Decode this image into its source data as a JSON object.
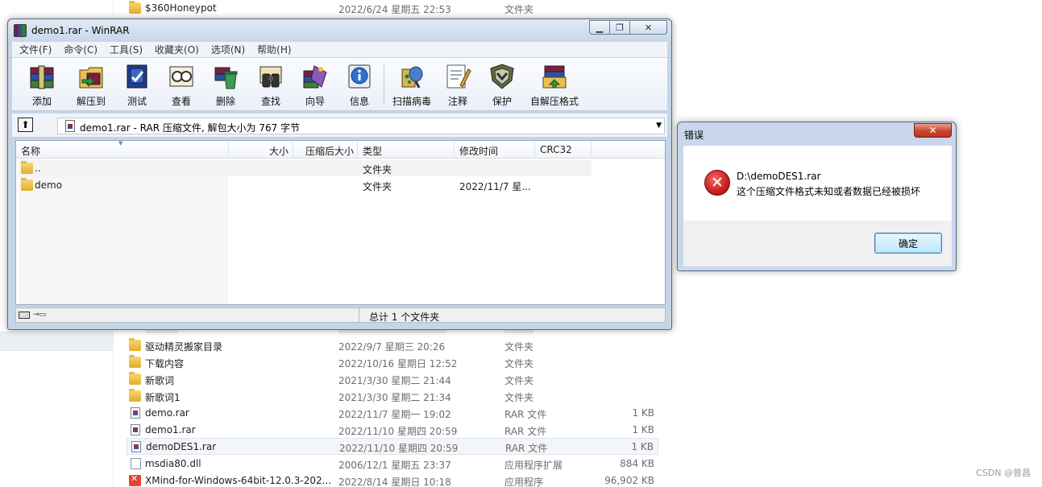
{
  "explorer": {
    "rows_top": [
      {
        "name": "$360Honeypot",
        "date": "2022/6/24 星期五 22:53",
        "type": "文件夹",
        "size": "",
        "icon": "folder-icon"
      }
    ],
    "rows_bottom": [
      {
        "name": "驱动精灵搬家目录",
        "date": "2022/9/7 星期三 20:26",
        "type": "文件夹",
        "size": "",
        "icon": "folder-icon"
      },
      {
        "name": "下载内容",
        "date": "2022/10/16 星期日 12:52",
        "type": "文件夹",
        "size": "",
        "icon": "folder-icon"
      },
      {
        "name": "新歌词",
        "date": "2021/3/30 星期二 21:44",
        "type": "文件夹",
        "size": "",
        "icon": "folder-icon"
      },
      {
        "name": "新歌词1",
        "date": "2021/3/30 星期二 21:34",
        "type": "文件夹",
        "size": "",
        "icon": "folder-icon"
      },
      {
        "name": "demo.rar",
        "date": "2022/11/7 星期一 19:02",
        "type": "RAR 文件",
        "size": "1 KB",
        "icon": "rar-file-icon"
      },
      {
        "name": "demo1.rar",
        "date": "2022/11/10 星期四 20:59",
        "type": "RAR 文件",
        "size": "1 KB",
        "icon": "rar-file-icon"
      },
      {
        "name": "demoDES1.rar",
        "date": "2022/11/10 星期四 20:59",
        "type": "RAR 文件",
        "size": "1 KB",
        "icon": "rar-file-icon",
        "selected": true
      },
      {
        "name": "msdia80.dll",
        "date": "2006/12/1 星期五 23:37",
        "type": "应用程序扩展",
        "size": "884 KB",
        "icon": "dll-file-icon"
      },
      {
        "name": "XMind-for-Windows-64bit-12.0.3-202...",
        "date": "2022/8/14 星期日 10:18",
        "type": "应用程序",
        "size": "96,902 KB",
        "icon": "xmind-app-icon"
      }
    ],
    "watermark": "CSDN @曾昌"
  },
  "winrar": {
    "title": "demo1.rar - WinRAR",
    "menu": [
      "文件(F)",
      "命令(C)",
      "工具(S)",
      "收藏夹(O)",
      "选项(N)",
      "帮助(H)"
    ],
    "toolbar": [
      {
        "label": "添加",
        "icon": "add-archive-icon"
      },
      {
        "label": "解压到",
        "icon": "extract-to-icon"
      },
      {
        "label": "测试",
        "icon": "test-archive-icon"
      },
      {
        "label": "查看",
        "icon": "view-file-icon"
      },
      {
        "label": "删除",
        "icon": "delete-file-icon"
      },
      {
        "label": "查找",
        "icon": "find-binoculars-icon"
      },
      {
        "label": "向导",
        "icon": "wizard-icon"
      },
      {
        "label": "信息",
        "icon": "info-icon"
      },
      {
        "label": "扫描病毒",
        "icon": "scan-virus-icon"
      },
      {
        "label": "注释",
        "icon": "comment-icon"
      },
      {
        "label": "保护",
        "icon": "protect-shield-icon"
      },
      {
        "label": "自解压格式",
        "icon": "sfx-icon"
      }
    ],
    "address": "demo1.rar - RAR 压缩文件, 解包大小为 767 字节",
    "columns": {
      "name": "名称",
      "size": "大小",
      "packed": "压缩后大小",
      "type": "类型",
      "modified": "修改时间",
      "crc": "CRC32"
    },
    "rows": [
      {
        "name": "..",
        "type": "文件夹",
        "date": ""
      },
      {
        "name": "demo",
        "type": "文件夹",
        "date": "2022/11/7 星..."
      }
    ],
    "status": "总计 1 个文件夹"
  },
  "dialog": {
    "title": "错误",
    "close": "✕",
    "line1": "D:\\demoDES1.rar",
    "line2": "这个压缩文件格式未知或者数据已经被损坏",
    "ok_label": "确定",
    "icon": "error-icon"
  },
  "colors": {
    "window_frame": "#c5d5e8",
    "selection": "#f2f5f9",
    "error_red": "#c81e1e",
    "ok_button": "#bee6fd"
  }
}
